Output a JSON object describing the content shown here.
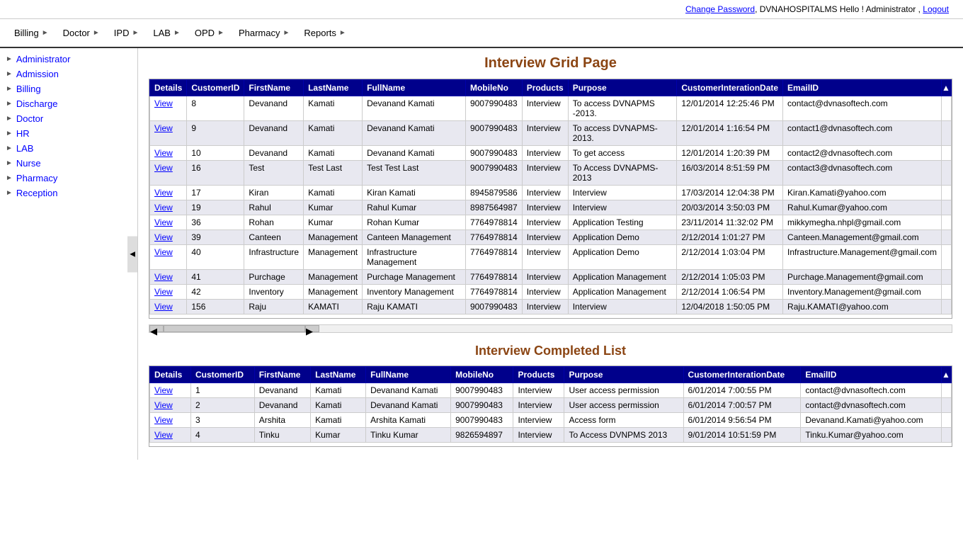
{
  "topbar": {
    "change_password": "Change Password",
    "hospital": "DVNAHOSPITALMS",
    "greeting": "Hello ! Administrator ,",
    "logout": "Logout"
  },
  "nav": {
    "items": [
      {
        "label": "Billing",
        "has_arrow": true
      },
      {
        "label": "Doctor",
        "has_arrow": true
      },
      {
        "label": "IPD",
        "has_arrow": true
      },
      {
        "label": "LAB",
        "has_arrow": true
      },
      {
        "label": "OPD",
        "has_arrow": true
      },
      {
        "label": "Pharmacy",
        "has_arrow": true
      },
      {
        "label": "Reports",
        "has_arrow": true
      }
    ]
  },
  "sidebar": {
    "items": [
      {
        "label": "Administrator"
      },
      {
        "label": "Admission"
      },
      {
        "label": "Billing"
      },
      {
        "label": "Discharge"
      },
      {
        "label": "Doctor"
      },
      {
        "label": "HR"
      },
      {
        "label": "LAB"
      },
      {
        "label": "Nurse"
      },
      {
        "label": "Pharmacy"
      },
      {
        "label": "Reception"
      }
    ]
  },
  "main": {
    "grid_title": "Interview Grid Page",
    "grid_columns": [
      "Details",
      "CustomerID",
      "FirstName",
      "LastName",
      "FullName",
      "MobileNo",
      "Products",
      "Purpose",
      "CustomerInterationDate",
      "EmailID"
    ],
    "grid_rows": [
      {
        "details": "View",
        "customerid": "8",
        "firstname": "Devanand",
        "lastname": "Kamati",
        "fullname": "Devanand Kamati",
        "mobileno": "9007990483",
        "products": "Interview",
        "purpose": "To access DVNAPMS -2013.",
        "date": "12/01/2014 12:25:46 PM",
        "email": "contact@dvnasoftech.com"
      },
      {
        "details": "View",
        "customerid": "9",
        "firstname": "Devanand",
        "lastname": "Kamati",
        "fullname": "Devanand Kamati",
        "mobileno": "9007990483",
        "products": "Interview",
        "purpose": "To access DVNAPMS-2013.",
        "date": "12/01/2014 1:16:54 PM",
        "email": "contact1@dvnasoftech.com"
      },
      {
        "details": "View",
        "customerid": "10",
        "firstname": "Devanand",
        "lastname": "Kamati",
        "fullname": "Devanand Kamati",
        "mobileno": "9007990483",
        "products": "Interview",
        "purpose": "To get access",
        "date": "12/01/2014 1:20:39 PM",
        "email": "contact2@dvnasoftech.com"
      },
      {
        "details": "View",
        "customerid": "16",
        "firstname": "Test",
        "lastname": "Test Last",
        "fullname": "Test Test Last",
        "mobileno": "9007990483",
        "products": "Interview",
        "purpose": "To Access DVNAPMS-2013",
        "date": "16/03/2014 8:51:59 PM",
        "email": "contact3@dvnasoftech.com"
      },
      {
        "details": "View",
        "customerid": "17",
        "firstname": "Kiran",
        "lastname": "Kamati",
        "fullname": "Kiran Kamati",
        "mobileno": "8945879586",
        "products": "Interview",
        "purpose": "Interview",
        "date": "17/03/2014 12:04:38 PM",
        "email": "Kiran.Kamati@yahoo.com"
      },
      {
        "details": "View",
        "customerid": "19",
        "firstname": "Rahul",
        "lastname": "Kumar",
        "fullname": "Rahul Kumar",
        "mobileno": "8987564987",
        "products": "Interview",
        "purpose": "Interview",
        "date": "20/03/2014 3:50:03 PM",
        "email": "Rahul.Kumar@yahoo.com"
      },
      {
        "details": "View",
        "customerid": "36",
        "firstname": "Rohan",
        "lastname": "Kumar",
        "fullname": "Rohan Kumar",
        "mobileno": "7764978814",
        "products": "Interview",
        "purpose": "Application Testing",
        "date": "23/11/2014 11:32:02 PM",
        "email": "mikkymegha.nhpl@gmail.com"
      },
      {
        "details": "View",
        "customerid": "39",
        "firstname": "Canteen",
        "lastname": "Management",
        "fullname": "Canteen Management",
        "mobileno": "7764978814",
        "products": "Interview",
        "purpose": "Application Demo",
        "date": "2/12/2014 1:01:27 PM",
        "email": "Canteen.Management@gmail.com"
      },
      {
        "details": "View",
        "customerid": "40",
        "firstname": "Infrastructure",
        "lastname": "Management",
        "fullname": "Infrastructure Management",
        "mobileno": "7764978814",
        "products": "Interview",
        "purpose": "Application Demo",
        "date": "2/12/2014 1:03:04 PM",
        "email": "Infrastructure.Management@gmail.com"
      },
      {
        "details": "View",
        "customerid": "41",
        "firstname": "Purchage",
        "lastname": "Management",
        "fullname": "Purchage Management",
        "mobileno": "7764978814",
        "products": "Interview",
        "purpose": "Application Management",
        "date": "2/12/2014 1:05:03 PM",
        "email": "Purchage.Management@gmail.com"
      },
      {
        "details": "View",
        "customerid": "42",
        "firstname": "Inventory",
        "lastname": "Management",
        "fullname": "Inventory Management",
        "mobileno": "7764978814",
        "products": "Interview",
        "purpose": "Application Management",
        "date": "2/12/2014 1:06:54 PM",
        "email": "Inventory.Management@gmail.com"
      },
      {
        "details": "View",
        "customerid": "156",
        "firstname": "Raju",
        "lastname": "KAMATI",
        "fullname": "Raju KAMATI",
        "mobileno": "9007990483",
        "products": "Interview",
        "purpose": "Interview",
        "date": "12/04/2018 1:50:05 PM",
        "email": "Raju.KAMATI@yahoo.com"
      }
    ],
    "completed_title": "Interview Completed List",
    "completed_columns": [
      "Details",
      "CustomerID",
      "FirstName",
      "LastName",
      "FullName",
      "MobileNo",
      "Products",
      "Purpose",
      "CustomerInterationDate",
      "EmailID"
    ],
    "completed_rows": [
      {
        "details": "View",
        "customerid": "1",
        "firstname": "Devanand",
        "lastname": "Kamati",
        "fullname": "Devanand Kamati",
        "mobileno": "9007990483",
        "products": "Interview",
        "purpose": "User access permission",
        "date": "6/01/2014 7:00:55 PM",
        "email": "contact@dvnasoftech.com"
      },
      {
        "details": "View",
        "customerid": "2",
        "firstname": "Devanand",
        "lastname": "Kamati",
        "fullname": "Devanand Kamati",
        "mobileno": "9007990483",
        "products": "Interview",
        "purpose": "User access permission",
        "date": "6/01/2014 7:00:57 PM",
        "email": "contact@dvnasoftech.com"
      },
      {
        "details": "View",
        "customerid": "3",
        "firstname": "Arshita",
        "lastname": "Kamati",
        "fullname": "Arshita Kamati",
        "mobileno": "9007990483",
        "products": "Interview",
        "purpose": "Access form",
        "date": "6/01/2014 9:56:54 PM",
        "email": "Devanand.Kamati@yahoo.com"
      },
      {
        "details": "View",
        "customerid": "4",
        "firstname": "Tinku",
        "lastname": "Kumar",
        "fullname": "Tinku Kumar",
        "mobileno": "9826594897",
        "products": "Interview",
        "purpose": "To Access DVNPMS 2013",
        "date": "9/01/2014 10:51:59 PM",
        "email": "Tinku.Kumar@yahoo.com"
      }
    ]
  }
}
